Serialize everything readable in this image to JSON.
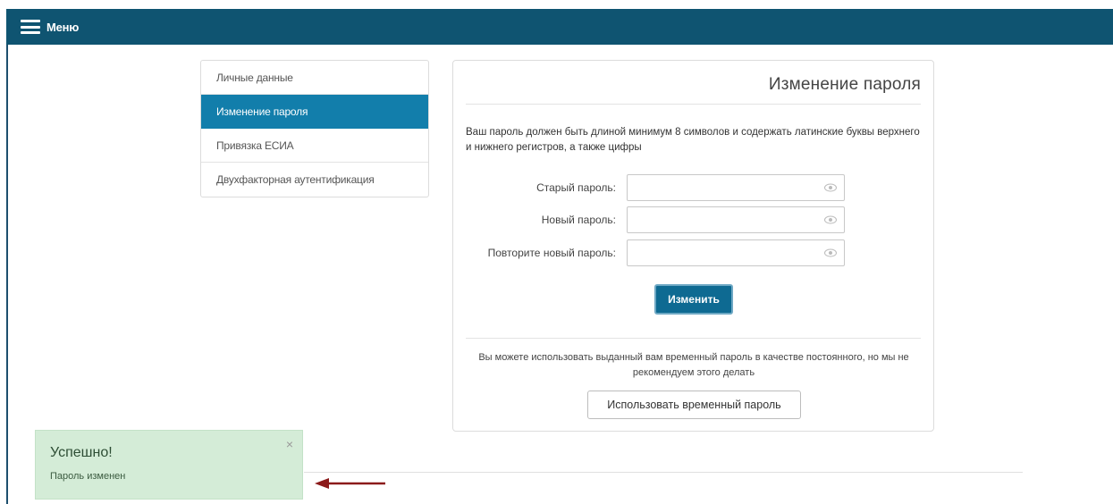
{
  "topbar": {
    "menu_label": "Меню",
    "menu_icon": "hamburger-icon",
    "color": "#0f5471"
  },
  "sidebar": {
    "items": [
      {
        "label": "Личные данные"
      },
      {
        "label": "Изменение пароля",
        "active": true
      },
      {
        "label": "Привязка ЕСИА"
      },
      {
        "label": "Двухфакторная аутентификация"
      }
    ],
    "active_color": "#127eab"
  },
  "card": {
    "title": "Изменение пароля",
    "hint": "Ваш пароль должен быть длиной минимум 8 символов и содержать латинские буквы верхнего и нижнего регистров, а также цифры",
    "fields": {
      "old_label": "Старый пароль:",
      "new_label": "Новый пароль:",
      "repeat_label": "Повторите новый пароль:",
      "old_value": "",
      "new_value": "",
      "repeat_value": "",
      "icon": "eye-icon"
    },
    "submit_label": "Изменить",
    "note": "Вы можете использовать выданный вам временный пароль в качестве постоянного, но мы не рекомендуем этого делать",
    "temp_button_label": "Использовать временный пароль"
  },
  "toast": {
    "title": "Успешно!",
    "message": "Пароль изменен",
    "close": "×",
    "color": "#d4ecd7"
  },
  "annotation": {
    "arrow_color": "#8b1a1a"
  }
}
